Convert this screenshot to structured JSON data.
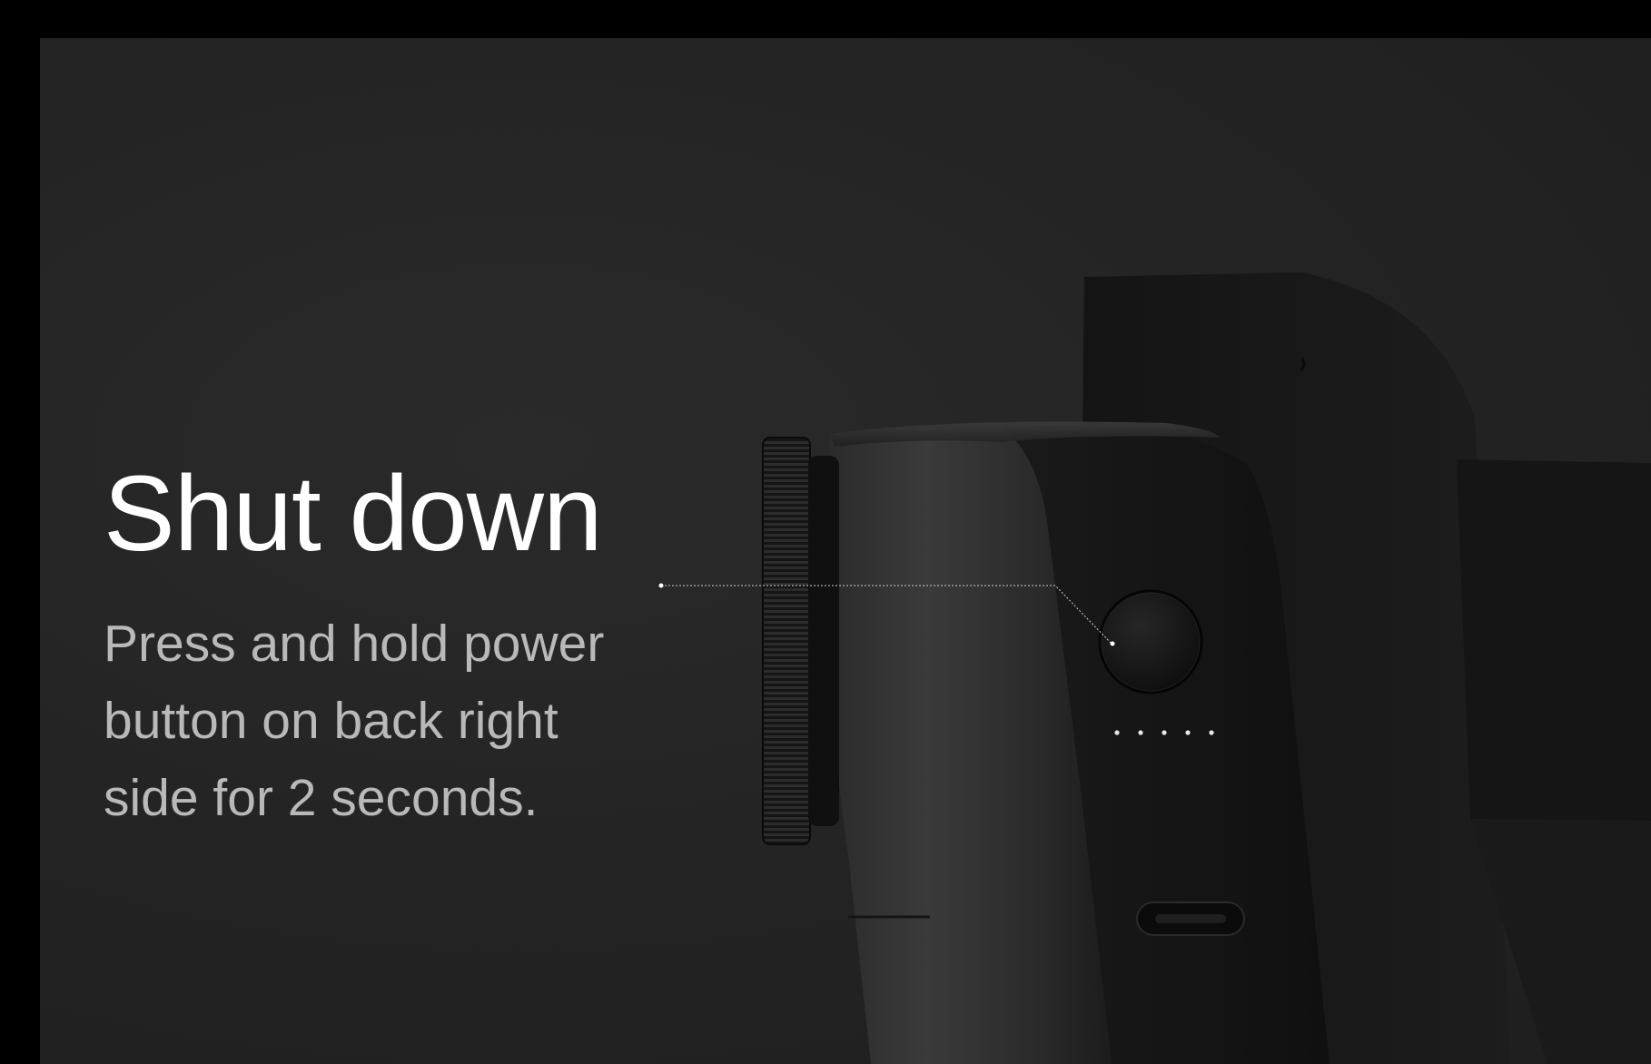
{
  "instruction": {
    "title": "Shut down",
    "description": "Press and hold power button on back right side for 2 seconds."
  },
  "colors": {
    "background": "#232323",
    "title": "#ffffff",
    "description": "#b9b9b9",
    "device_body": "#161616",
    "callout_line": "#d0d0d0"
  },
  "icons": [
    "power-button-icon",
    "status-led-dots",
    "usb-c-port-icon",
    "focus-dial-icon"
  ]
}
